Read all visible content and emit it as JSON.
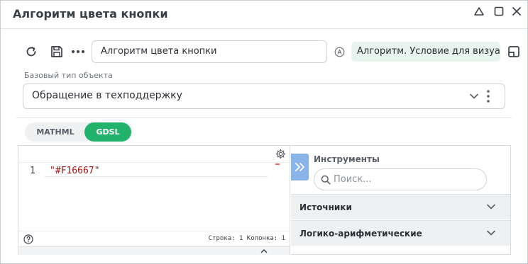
{
  "window": {
    "title": "Алгоритм цвета кнопки"
  },
  "toolbar": {
    "name_value": "Алгоритм цвета кнопки",
    "chip_label": "Алгоритм. Условие для визуала"
  },
  "base_type": {
    "label": "Базовый тип объекта",
    "value": "Обращение в техподдержку"
  },
  "tabs": [
    {
      "label": "MATHML",
      "active": false
    },
    {
      "label": "GDSL",
      "active": true
    }
  ],
  "editor": {
    "line_number": "1",
    "code": "\"#F16667\"",
    "status": "Строка: 1 Колонка: 1"
  },
  "tools": {
    "title": "Инструменты",
    "search_placeholder": "Поиск...",
    "sections": [
      {
        "label": "Источники"
      },
      {
        "label": "Логико-арифметические"
      }
    ]
  },
  "colors": {
    "accent": "#21b36b",
    "chip_bg": "#e6f4ed",
    "panel_toggle": "#8ab4e8",
    "code_string": "#a31515"
  }
}
